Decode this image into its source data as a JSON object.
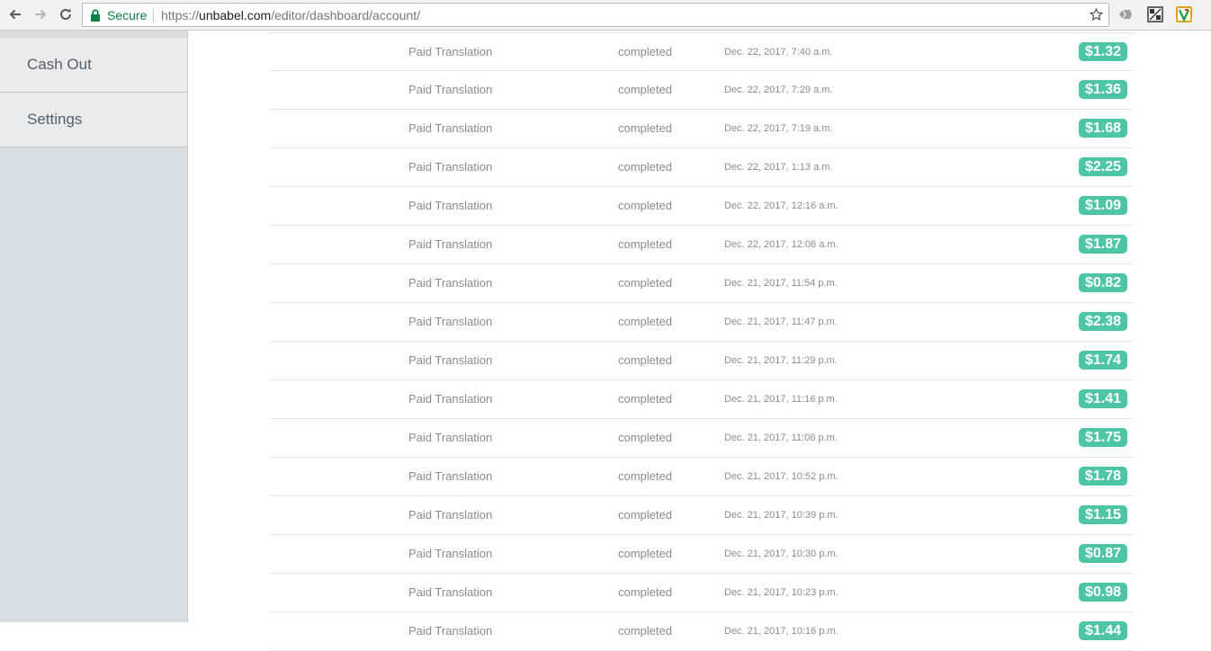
{
  "browser": {
    "secure_label": "Secure",
    "url_scheme": "https://",
    "url_host": "unbabel.com",
    "url_path": "/editor/dashboard/account/",
    "icons": [
      "back-arrow-icon",
      "forward-arrow-icon",
      "reload-icon",
      "lock-icon",
      "star-icon"
    ],
    "colors": {
      "secure": "#0b8043"
    }
  },
  "sidebar": {
    "items": [
      {
        "label": "Cash Out"
      },
      {
        "label": "Settings"
      }
    ]
  },
  "transactions": [
    {
      "description": "Paid Translation",
      "status": "completed",
      "date": "Dec. 22, 2017, 7:40 a.m.",
      "amount": "$1.32"
    },
    {
      "description": "Paid Translation",
      "status": "completed",
      "date": "Dec. 22, 2017, 7:29 a.m.",
      "amount": "$1.36"
    },
    {
      "description": "Paid Translation",
      "status": "completed",
      "date": "Dec. 22, 2017, 7:19 a.m.",
      "amount": "$1.68"
    },
    {
      "description": "Paid Translation",
      "status": "completed",
      "date": "Dec. 22, 2017, 1:13 a.m.",
      "amount": "$2.25"
    },
    {
      "description": "Paid Translation",
      "status": "completed",
      "date": "Dec. 22, 2017, 12:16 a.m.",
      "amount": "$1.09"
    },
    {
      "description": "Paid Translation",
      "status": "completed",
      "date": "Dec. 22, 2017, 12:08 a.m.",
      "amount": "$1.87"
    },
    {
      "description": "Paid Translation",
      "status": "completed",
      "date": "Dec. 21, 2017, 11:54 p.m.",
      "amount": "$0.82"
    },
    {
      "description": "Paid Translation",
      "status": "completed",
      "date": "Dec. 21, 2017, 11:47 p.m.",
      "amount": "$2.38"
    },
    {
      "description": "Paid Translation",
      "status": "completed",
      "date": "Dec. 21, 2017, 11:29 p.m.",
      "amount": "$1.74"
    },
    {
      "description": "Paid Translation",
      "status": "completed",
      "date": "Dec. 21, 2017, 11:16 p.m.",
      "amount": "$1.41"
    },
    {
      "description": "Paid Translation",
      "status": "completed",
      "date": "Dec. 21, 2017, 11:06 p.m.",
      "amount": "$1.75"
    },
    {
      "description": "Paid Translation",
      "status": "completed",
      "date": "Dec. 21, 2017, 10:52 p.m.",
      "amount": "$1.78"
    },
    {
      "description": "Paid Translation",
      "status": "completed",
      "date": "Dec. 21, 2017, 10:39 p.m.",
      "amount": "$1.15"
    },
    {
      "description": "Paid Translation",
      "status": "completed",
      "date": "Dec. 21, 2017, 10:30 p.m.",
      "amount": "$0.87"
    },
    {
      "description": "Paid Translation",
      "status": "completed",
      "date": "Dec. 21, 2017, 10:23 p.m.",
      "amount": "$0.98"
    },
    {
      "description": "Paid Translation",
      "status": "completed",
      "date": "Dec. 21, 2017, 10:16 p.m.",
      "amount": "$1.44"
    }
  ],
  "theme": {
    "amount_badge": "#4ec6a6",
    "sidebar_bg": "#d8dde1"
  }
}
